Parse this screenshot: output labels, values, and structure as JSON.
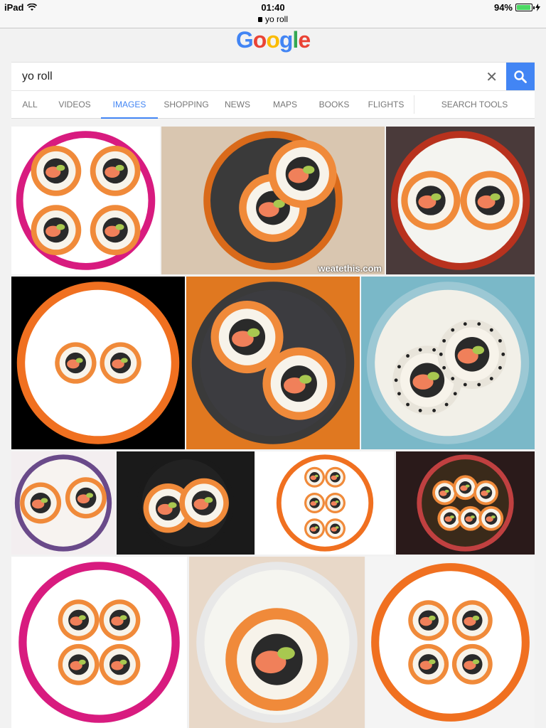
{
  "status": {
    "device": "iPad",
    "time": "01:40",
    "url": "yo roll",
    "battery": "94%",
    "battery_level": 0.94
  },
  "logo": {
    "letters": [
      "G",
      "o",
      "o",
      "g",
      "l",
      "e"
    ],
    "colors": [
      "#4285f4",
      "#ea4335",
      "#fbbc05",
      "#4285f4",
      "#34a853",
      "#ea4335"
    ]
  },
  "search": {
    "value": "yo roll"
  },
  "tabs": [
    "ALL",
    "VIDEOS",
    "IMAGES",
    "SHOPPING",
    "NEWS",
    "MAPS",
    "BOOKS",
    "FLIGHTS"
  ],
  "active_tab": "IMAGES",
  "search_tools": "SEARCH TOOLS",
  "results": [
    {
      "watermark": ""
    },
    {
      "watermark": "weatethis.com"
    },
    {
      "watermark": ""
    },
    {
      "watermark": ""
    },
    {
      "watermark": ""
    },
    {
      "watermark": ""
    },
    {
      "watermark": ""
    },
    {
      "watermark": ""
    },
    {
      "watermark": ""
    },
    {
      "watermark": ""
    },
    {
      "watermark": ""
    },
    {
      "watermark": ""
    },
    {
      "watermark": ""
    }
  ],
  "colors": {
    "accent": "#4285f4",
    "pink_rim": "#d81b7f",
    "orange_rim": "#f07020"
  }
}
